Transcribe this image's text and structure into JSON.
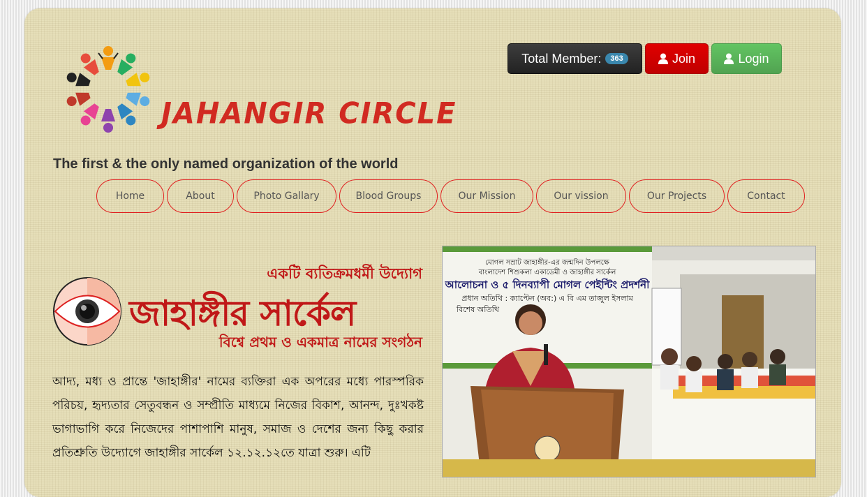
{
  "header": {
    "brand": "JAHANGIR CIRCLE",
    "tagline": "The first & the only named organization of the world",
    "total_member_label": "Total Member:",
    "total_member_count": "363",
    "join_label": "Join",
    "login_label": "Login"
  },
  "nav": {
    "items": [
      {
        "label": "Home"
      },
      {
        "label": "About"
      },
      {
        "label": "Photo Gallary"
      },
      {
        "label": "Blood Groups"
      },
      {
        "label": "Our Mission"
      },
      {
        "label": "Our vission"
      },
      {
        "label": "Our Projects"
      },
      {
        "label": "Contact"
      }
    ]
  },
  "intro": {
    "slogan": "একটি ব্যতিক্রমধর্মী উদ্যোগ",
    "title": "জাহাঙ্গীর সার্কেল",
    "subtitle": "বিশ্বে প্রথম ও একমাত্র নামের সংগঠন",
    "paragraph": "আদ্য, মধ্য ও প্রান্তে 'জাহাঙ্গীর' নামের ব্যক্তিরা এক অপরের মধ্যে পারস্পরিক পরিচয়, হৃদ্যতার সেতুবন্ধন ও সম্প্রীতি মাধ্যমে নিজের বিকাশ, আনন্দ, দুঃখকষ্ট ভাগাভাগি করে নিজেদের পাশাপাশি মানুষ, সমাজ ও দেশের জন্য কিছু করার প্রতিশ্রুতি উদ্যোগে জাহাঙ্গীর সার্কেল ১২.১২.১২তে যাত্রা শুরু। এটি"
  },
  "photo": {
    "banner_lines": [
      "মোগল সম্রাট জাহাঙ্গীর-এর জন্মদিন উপলক্ষে",
      "বাংলাদেশ শিশুকলা একাডেমী ও জাহাঙ্গীর সার্কেল",
      "আলোচনা ও ৫ দিনব্যাপী মোগল পেইন্টিং প্রদর্শনী",
      "প্রধান অতিথি : ক্যাপ্টেন (অব:) এ বি এম তাজুল ইসলাম",
      "বিশেষ অতিথি"
    ]
  },
  "colors": {
    "brand_red": "#d12a21",
    "page_bg": "#e6dfb9",
    "join": "#d00000",
    "login": "#5cb85c",
    "badge": "#3a87ad"
  }
}
